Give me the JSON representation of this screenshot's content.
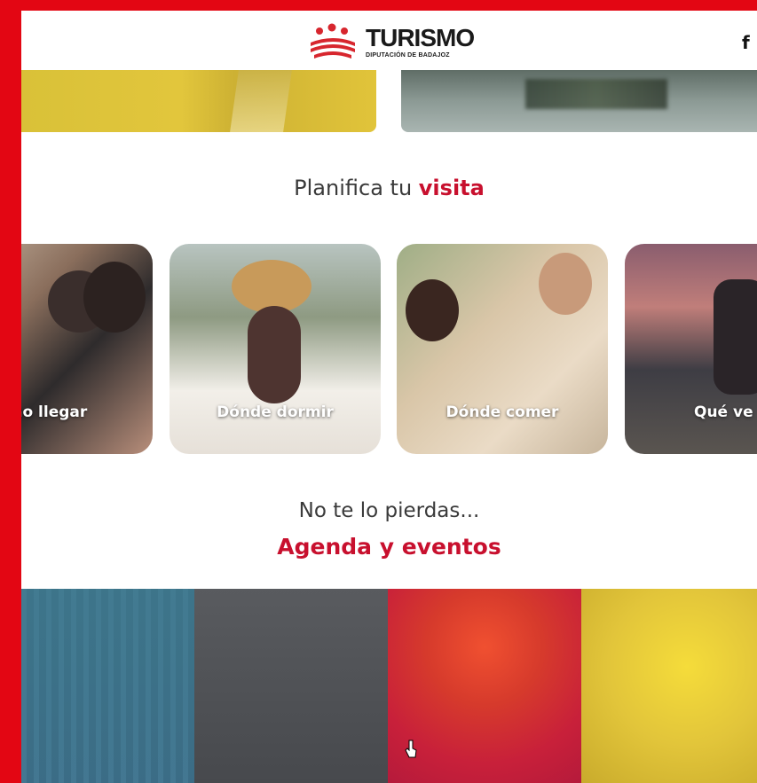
{
  "header": {
    "logo_text": "TURISMO",
    "logo_subtitle": "DIPUTACIÓN DE BADAJOZ",
    "social_icon": "facebook-icon",
    "social_glyph": "f"
  },
  "plan": {
    "title_prefix": "Planifica tu ",
    "title_highlight": "visita"
  },
  "cards": [
    {
      "label": "mo llegar"
    },
    {
      "label": "Dónde dormir"
    },
    {
      "label": "Dónde comer"
    },
    {
      "label": "Qué ve"
    }
  ],
  "agenda": {
    "intro": "No te lo pierdas...",
    "title": "Agenda y eventos"
  },
  "colors": {
    "brand_red": "#c8102e",
    "frame_red": "#e30613",
    "text_gray": "#3a3a3a"
  }
}
